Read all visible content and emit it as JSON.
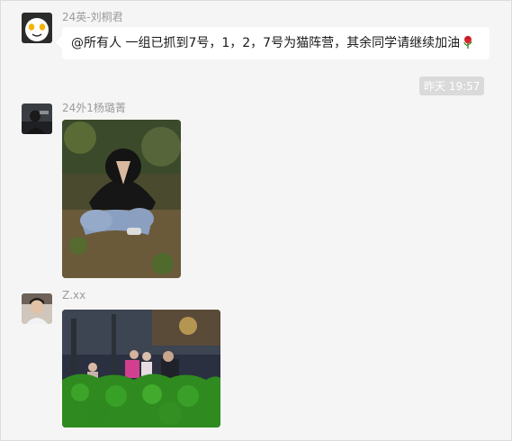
{
  "messages": [
    {
      "sender": "24英-刘桐君",
      "avatar": "cartoon-egg-face-avatar",
      "text": "@所有人 一组已抓到7号，1，2，7号为猫阵营，其余同学请继续加油",
      "emoji": "rose-icon"
    },
    {
      "timestamp": "昨天 19:57"
    },
    {
      "sender": "24外1杨璐菁",
      "avatar": "dark-photo-avatar",
      "image": "photo-person-crouching-praying"
    },
    {
      "sender": "Z.xx",
      "avatar": "person-photo-avatar",
      "image": "photo-group-behind-hedge-night"
    }
  ],
  "colors": {
    "background": "#f5f5f5",
    "bubble": "#ffffff",
    "sender_name": "#9b9b9b",
    "timestamp_chip": "#dadada"
  }
}
